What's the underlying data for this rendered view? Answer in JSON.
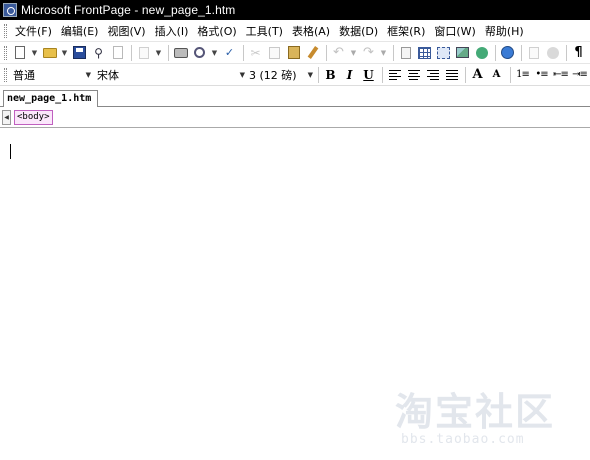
{
  "window": {
    "title": "Microsoft FrontPage - new_page_1.htm"
  },
  "menubar": {
    "items": [
      "文件(F)",
      "编辑(E)",
      "视图(V)",
      "插入(I)",
      "格式(O)",
      "工具(T)",
      "表格(A)",
      "数据(D)",
      "框架(R)",
      "窗口(W)",
      "帮助(H)"
    ]
  },
  "toolbar1": {
    "icons": [
      "new-page-icon",
      "open-folder-icon",
      "save-icon",
      "search-icon",
      "publish-icon",
      "print-icon",
      "print-preview-icon",
      "spelling-icon",
      "cut-icon",
      "copy-icon",
      "paste-icon",
      "format-painter-icon",
      "undo-icon",
      "redo-icon",
      "web-component-icon",
      "insert-table-icon",
      "insert-layer-icon",
      "insert-picture-icon",
      "drawing-icon",
      "hyperlink-icon",
      "refresh-icon",
      "stop-icon",
      "show-all-icon",
      "bookmark-icon"
    ]
  },
  "toolbar2": {
    "style": "普通",
    "font": "宋体",
    "size": "3 (12 磅)",
    "bold": "B",
    "italic": "I",
    "underline": "U",
    "grow_font": "A",
    "shrink_font": "A"
  },
  "tab": {
    "label": "new_page_1.htm"
  },
  "quicktag": {
    "tag": "<body>"
  },
  "watermark": {
    "main": "淘宝社区",
    "url": "bbs.taobao.com"
  }
}
